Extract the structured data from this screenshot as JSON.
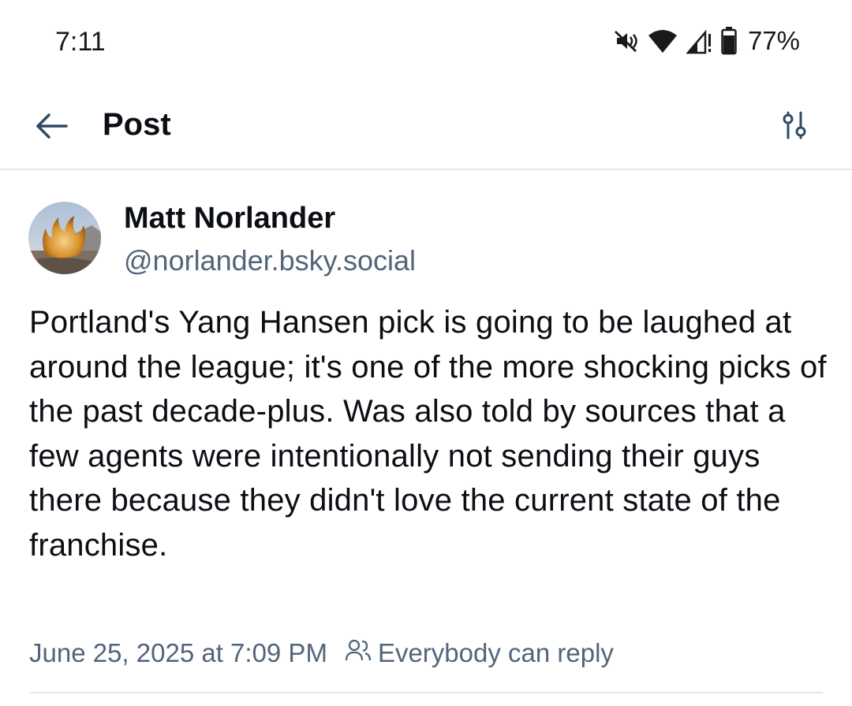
{
  "status_bar": {
    "time": "7:11",
    "battery_percent": "77%",
    "icons": [
      "mute-icon",
      "wifi-icon",
      "signal-icon",
      "battery-icon"
    ]
  },
  "header": {
    "title": "Post",
    "back_icon": "arrow-left-icon",
    "settings_icon": "sliders-icon"
  },
  "post": {
    "author_name": "Matt Norlander",
    "author_handle": "@norlander.bsky.social",
    "text": "Portland's Yang Hansen pick is going to be laughed at around the league; it's one of the more shocking picks of the past decade-plus. Was also told by sources that a few agents were intentionally not sending their guys there because they didn't love the current state of the franchise.",
    "timestamp": "June 25, 2025 at 7:09 PM",
    "reply_setting": "Everybody can reply",
    "reply_icon": "people-icon"
  },
  "colors": {
    "text_primary": "#0b0f14",
    "text_secondary": "#52657a",
    "divider": "#e4e8ec",
    "icon": "#2b4a66"
  }
}
